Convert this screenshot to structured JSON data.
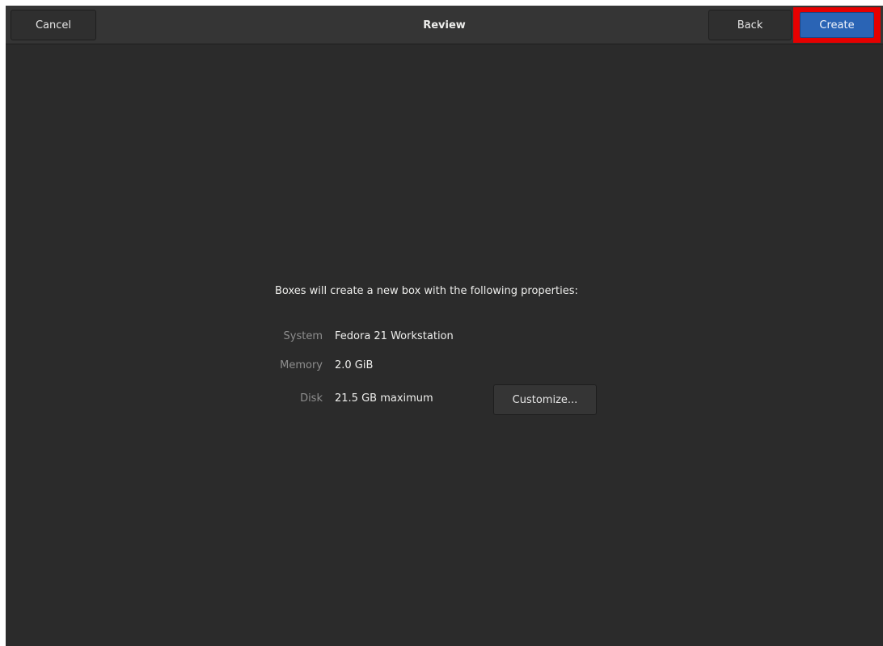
{
  "header": {
    "title": "Review",
    "cancel_label": "Cancel",
    "back_label": "Back",
    "create_label": "Create"
  },
  "review": {
    "intro": "Boxes will create a new box with the following properties:",
    "properties": [
      {
        "label": "System",
        "value": "Fedora 21 Workstation"
      },
      {
        "label": "Memory",
        "value": "2.0 GiB"
      },
      {
        "label": "Disk",
        "value": "21.5 GB maximum"
      }
    ],
    "customize_label": "Customize..."
  },
  "colors": {
    "window_bg": "#2b2b2b",
    "headerbar_bg": "#353535",
    "suggested_action": "#2a64b5",
    "highlight_box": "#e60000"
  }
}
